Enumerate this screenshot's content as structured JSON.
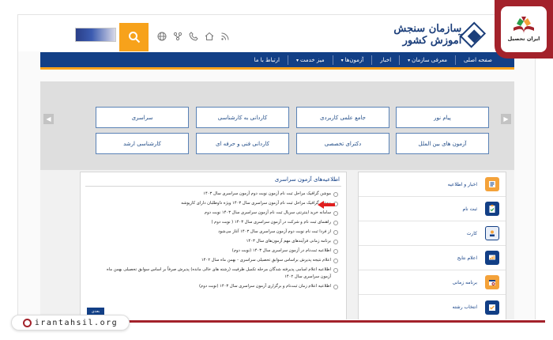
{
  "brand": {
    "name": "ایران تحصیل",
    "website": "irantahsil.org"
  },
  "header": {
    "org_name": "سازمان سنجش آموزش کشور",
    "icons": [
      "rss-icon",
      "home-icon",
      "phone-icon",
      "sitemap-icon",
      "globe-icon"
    ]
  },
  "nav": {
    "items": [
      "صفحه اصلی",
      "معرفی سازمان",
      "اخبار",
      "آزمون‌ها",
      "میز خدمت",
      "ارتباط با ما"
    ]
  },
  "exams": {
    "row1": [
      "پیام نور",
      "جامع علمی کاربردی",
      "کاردانی به کارشناسی",
      "سراسری"
    ],
    "row2": [
      "آزمون های بین الملل",
      "دکترای تخصصی",
      "کاردانی فنی و حرفه ای",
      "کارشناسی ارشد"
    ]
  },
  "news": {
    "title": "اطلاعیه‌های آزمون سراسری",
    "items": [
      "موشن گرافیک مراحل ثبت نام آزمون نوبت دوم آزمون سراسری سال ۱۴۰۳",
      "موشن گرافیک مراحل ثبت نام آزمون سراسری سال ۱۴۰۳ ویژه داوطلبان دارای کارپوشه",
      "سامانه خرید اینترنتی سریال ثبت نام آزمون سراسری سال ۱۴۰۳ نوبت دوم",
      "راهنمای ثبت نام و شرکت در آزمون سراسری سال ۱۴۰۳ ( نوبت دوم )",
      "از فردا ثبت نام نوبت دوم آزمون سراسری سال ۱۴۰۳ آغاز می‌شود",
      "برنامه زمانی فرآیندهای مهم آزمون‌های سال ۱۴۰۳",
      "اطلاعیه ثبت‌نام در آزمون سراسری سال ۱۴۰۳ (نوبت دوم)",
      "اعلام نتیجه پذیرش براساس سوابق تحصیلی سراسری - بهمن ماه سال ۱۴۰۲",
      "اطلاعیه اعلام اسامی پذیرفته شدگان مرحله تکمیل ظرفیت (رشته های خالی مانده) پذیرش صرفاً بر اساس سوابق تحصیلی بهمن ماه آزمون سراسری سال ۱۴۰۲",
      "اطلاعیه اعلام زمان ثبت‌نام و برگزاری آزمون سراسری سال ۱۴۰۳ (نوبت دوم)"
    ],
    "more_label": "بعدی"
  },
  "sidebar": {
    "items": [
      {
        "label": "اخبار و اطلاعیه",
        "icon": "news-icon"
      },
      {
        "label": "ثبت نام",
        "icon": "clipboard-icon"
      },
      {
        "label": "کارت",
        "icon": "id-card-icon"
      },
      {
        "label": "اعلام نتایج",
        "icon": "results-icon"
      },
      {
        "label": "برنامه زمانی",
        "icon": "calendar-icon"
      },
      {
        "label": "انتخاب رشته",
        "icon": "selection-icon"
      }
    ]
  },
  "colors": {
    "nav_blue": "#123f86",
    "accent_orange": "#f7a21b",
    "brand_red": "#a3222b",
    "tile_border": "#5a82b6"
  }
}
